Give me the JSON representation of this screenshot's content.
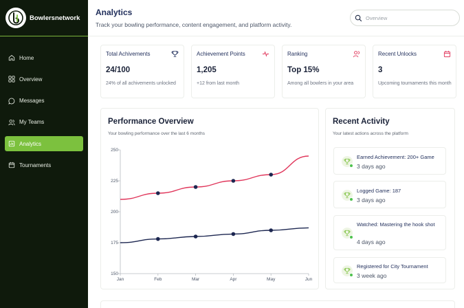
{
  "app": {
    "brand": "Bowlersnetwork"
  },
  "sidebar": {
    "items": [
      {
        "label": "Home",
        "icon": "home-icon"
      },
      {
        "label": "Overview",
        "icon": "grid-icon"
      },
      {
        "label": "Messages",
        "icon": "message-icon"
      },
      {
        "label": "My Teams",
        "icon": "users-icon"
      },
      {
        "label": "Analytics",
        "icon": "chart-icon",
        "active": true
      },
      {
        "label": "Tournaments",
        "icon": "calendar-icon"
      }
    ]
  },
  "header": {
    "title": "Analytics",
    "subtitle": "Track your bowling performance, content engagement, and platform activity.",
    "search_placeholder": "Overview"
  },
  "stats": [
    {
      "label": "Total Achivements",
      "value": "24/100",
      "note": "24% of all achivements unlocked",
      "icon": "trophy-icon"
    },
    {
      "label": "Achievement Points",
      "value": "1,205",
      "note": "+12 from last month",
      "icon": "activity-icon"
    },
    {
      "label": "Ranking",
      "value": "Top 15%",
      "note": "Among all bowlers in your area",
      "icon": "users-icon"
    },
    {
      "label": "Recent Unlocks",
      "value": "3",
      "note": "Upcoming tournaments this month",
      "icon": "calendar-icon"
    }
  ],
  "performance": {
    "title": "Performance Overview",
    "subtitle": "Your bowling performance over the last 6 months"
  },
  "chart_data": {
    "type": "line",
    "x": [
      "Jan",
      "Feb",
      "Mar",
      "Apr",
      "May",
      "Jun"
    ],
    "ylim": [
      150,
      250
    ],
    "yticks": [
      150,
      175,
      200,
      225,
      250
    ],
    "series": [
      {
        "values": [
          210,
          215,
          220,
          225,
          230,
          245
        ],
        "color": "#e0355a",
        "markers": [
          false,
          true,
          true,
          true,
          true,
          false
        ]
      },
      {
        "values": [
          175,
          178,
          180,
          182,
          185,
          187
        ],
        "color": "#1c2650",
        "markers": [
          false,
          true,
          true,
          true,
          true,
          false
        ]
      }
    ],
    "grid": false
  },
  "activity": {
    "title": "Recent Activity",
    "subtitle": "Your latest actions across the platform",
    "items": [
      {
        "title": "Earned Achievement: 200+ Game",
        "time": "3 days ago"
      },
      {
        "title": "Logged Game: 187",
        "time": "3 days ago"
      },
      {
        "title": "Watched: Mastering the hook shot",
        "time": "4 days ago"
      },
      {
        "title": "Registered for City Tournament",
        "time": "3 week ago"
      }
    ]
  },
  "colors": {
    "sidebar_bg": "#0f1a0c",
    "accent": "#7cc13e",
    "navy": "#1f2d5a",
    "red": "#e0355a"
  }
}
